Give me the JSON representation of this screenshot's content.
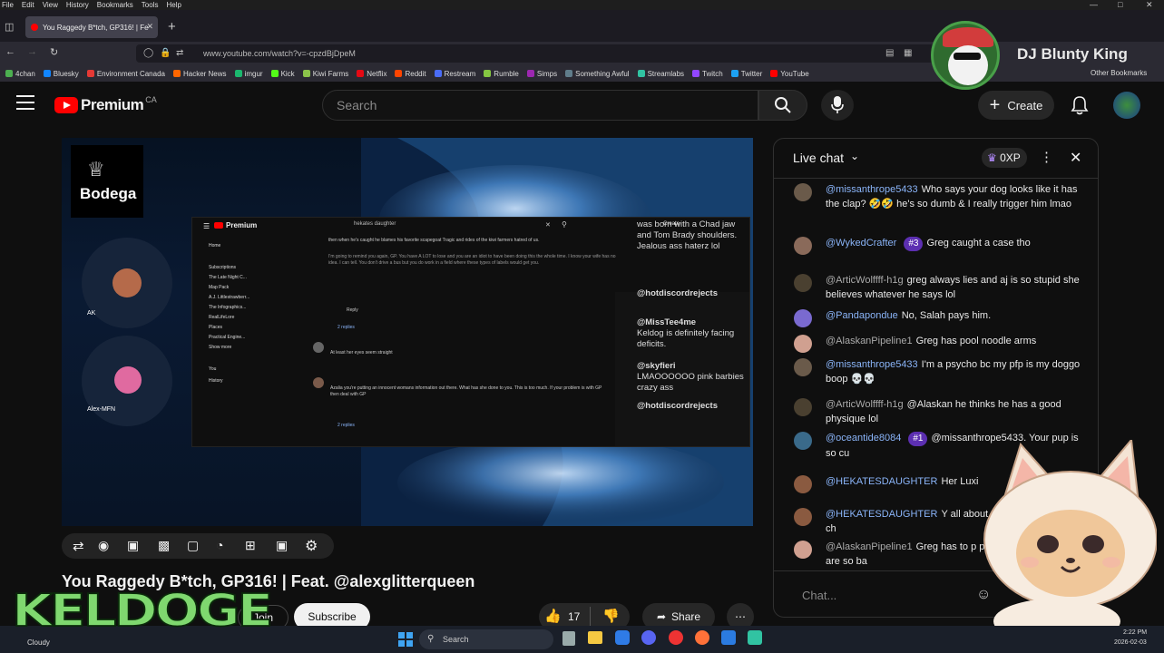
{
  "os_menu": [
    "File",
    "Edit",
    "View",
    "History",
    "Bookmarks",
    "Tools",
    "Help"
  ],
  "browser": {
    "tab_title": "You Raggedy B*tch, GP316! | Fe",
    "url": "www.youtube.com/watch?v=-cpzdBjDpeM"
  },
  "bookmarks": [
    {
      "label": "4chan",
      "color": "#4caf50"
    },
    {
      "label": "Bluesky",
      "color": "#1185fe"
    },
    {
      "label": "Environment Canada",
      "color": "#e53935"
    },
    {
      "label": "Hacker News",
      "color": "#ff6600"
    },
    {
      "label": "imgur",
      "color": "#1bb76e"
    },
    {
      "label": "Kick",
      "color": "#53fc18"
    },
    {
      "label": "Kiwi Farms",
      "color": "#8bc34a"
    },
    {
      "label": "Netflix",
      "color": "#e50914"
    },
    {
      "label": "Reddit",
      "color": "#ff4500"
    },
    {
      "label": "Restream",
      "color": "#4a6cf7"
    },
    {
      "label": "Rumble",
      "color": "#85c742"
    },
    {
      "label": "Simps",
      "color": "#9c27b0"
    },
    {
      "label": "Something Awful",
      "color": "#607d8b"
    },
    {
      "label": "Streamlabs",
      "color": "#31c3a2"
    },
    {
      "label": "Twitch",
      "color": "#9146ff"
    },
    {
      "label": "Twitter",
      "color": "#1da1f2"
    },
    {
      "label": "YouTube",
      "color": "#ff0000"
    }
  ],
  "bookmarks_other": "Other Bookmarks",
  "youtube": {
    "logo_text": "Premium",
    "logo_region": "CA",
    "search_placeholder": "Search",
    "create_label": "Create"
  },
  "video": {
    "title": "You Raggedy B*tch, GP316! | Feat. @alexglitterqueen",
    "channel_logo_text": "Bodega",
    "guest_1": "AK",
    "guest_2": "Alex-MFN",
    "inner_page": {
      "logo": "Premium",
      "search_text": "hekates daughter",
      "create": "Create",
      "sidebar": [
        "Home",
        "Subscriptions",
        "The Late Night C...",
        "Map Pack",
        "A.J. Littlestrawberr...",
        "The Infographics...",
        "RealLifeLore",
        "Places",
        "Practical Engine...",
        "Show more",
        "You",
        "History"
      ],
      "comment_text": "then when he's caught he blames his favorite scapegoat Tragic and rides of the kiwi farmers hatred of us.",
      "reply_label": "Reply",
      "replies_label": "2 replies",
      "comment_2": "At least her eyes seem straight",
      "comment_3": "Azalia you're putting an innocent womans information out there. What has she done to you. This is too much. If your problem is with GP then deal with GP"
    },
    "chat_overlay": [
      {
        "text": "was born with a Chad jaw and Tom Brady shoulders. Jealous ass haterz lol"
      },
      {
        "author": "@hotdiscordrejects"
      },
      {
        "author": "@MissTee4me",
        "text": "Keldog is definitely facing deficits."
      },
      {
        "author": "@skyfieri",
        "text": "LMAOOOOOO pink barbies crazy ass"
      },
      {
        "author": "@hotdiscordrejects"
      }
    ]
  },
  "actions": {
    "join": "Join",
    "subscribe": "Subscribe",
    "likes": "17",
    "share": "Share"
  },
  "chat": {
    "title": "Live chat",
    "xp": "0XP",
    "input_placeholder": "Chat...",
    "messages": [
      {
        "author": "@missanthrope5433",
        "badge": "",
        "text": "Who says your dog looks like it has the clap? 🤣🤣 he's so dumb & I really trigger him lmao",
        "avatar": "#6a5a4a"
      },
      {
        "author": "@WykedCrafter",
        "badge": "#3",
        "text": "Greg caught a case tho",
        "avatar": "#8a6a5a"
      },
      {
        "author": "@ArticWolffff-h1g",
        "badge": "",
        "text": "greg always lies and aj is so stupid she believes whatever he says lol",
        "avatar": "#4a4030"
      },
      {
        "author": "@Pandapondue",
        "badge": "",
        "text": "No, Salah pays him.",
        "avatar": "#7a6ad0"
      },
      {
        "author": "@AlaskanPipeline1",
        "badge": "",
        "text": "Greg has pool noodle arms",
        "avatar": "#d0a090"
      },
      {
        "author": "@missanthrope5433",
        "badge": "",
        "text": "I'm a psycho bc my pfp is my doggo boop 💀💀",
        "avatar": "#6a5a4a"
      },
      {
        "author": "@ArticWolffff-h1g",
        "badge": "",
        "text": "@Alaskan he thinks he has a good physique lol",
        "avatar": "#4a4030"
      },
      {
        "author": "@oceantide8084",
        "badge": "#1",
        "text": "@missanthrope5433. Your pup is so cu",
        "avatar": "#3a6a8a"
      },
      {
        "author": "@HEKATESDAUGHTER",
        "badge": "",
        "text": "Her Luxi",
        "avatar": "#8a5a40"
      },
      {
        "author": "@HEKATESDAUGHTER",
        "badge": "",
        "text": "Y all about... she wanted Greg to ch",
        "avatar": "#8a5a40"
      },
      {
        "author": "@AlaskanPipeline1",
        "badge": "",
        "text": "Greg has to p penis because his crabs are so ba",
        "avatar": "#d0a090"
      }
    ]
  },
  "taskbar": {
    "weather": "Cloudy",
    "search": "Search",
    "time": "2:22 PM",
    "date": "2026-02-03"
  },
  "overlay": {
    "streamer_name": "DJ Blunty King",
    "watermark": "KELDOGE"
  }
}
